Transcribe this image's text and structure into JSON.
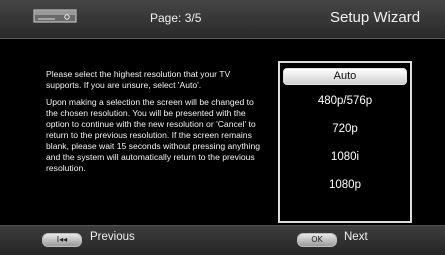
{
  "header": {
    "device_icon": "set-top-box-icon",
    "page_label": "Page: 3/5",
    "title": "Setup Wizard"
  },
  "instructions": {
    "paragraph1": "Please select the highest resolution that your TV supports. If you are unsure, select 'Auto'.",
    "paragraph2": "Upon making a selection the screen will be changed to the chosen resolution. You will be presented with the option to continue with the new resolution or 'Cancel' to return to the previous resolution. If the screen remains blank, please wait 15 seconds without pressing anything and the system will automatically return to the previous resolution."
  },
  "resolutions": {
    "selected": "Auto",
    "items": [
      "Auto",
      "480p/576p",
      "720p",
      "1080i",
      "1080p"
    ]
  },
  "footer": {
    "previous_key": "I◂◂",
    "previous_label": "Previous",
    "next_key": "OK",
    "next_label": "Next"
  },
  "colors": {
    "background": "#000000",
    "bar": "#333333",
    "highlight": "#e6e6e6"
  }
}
